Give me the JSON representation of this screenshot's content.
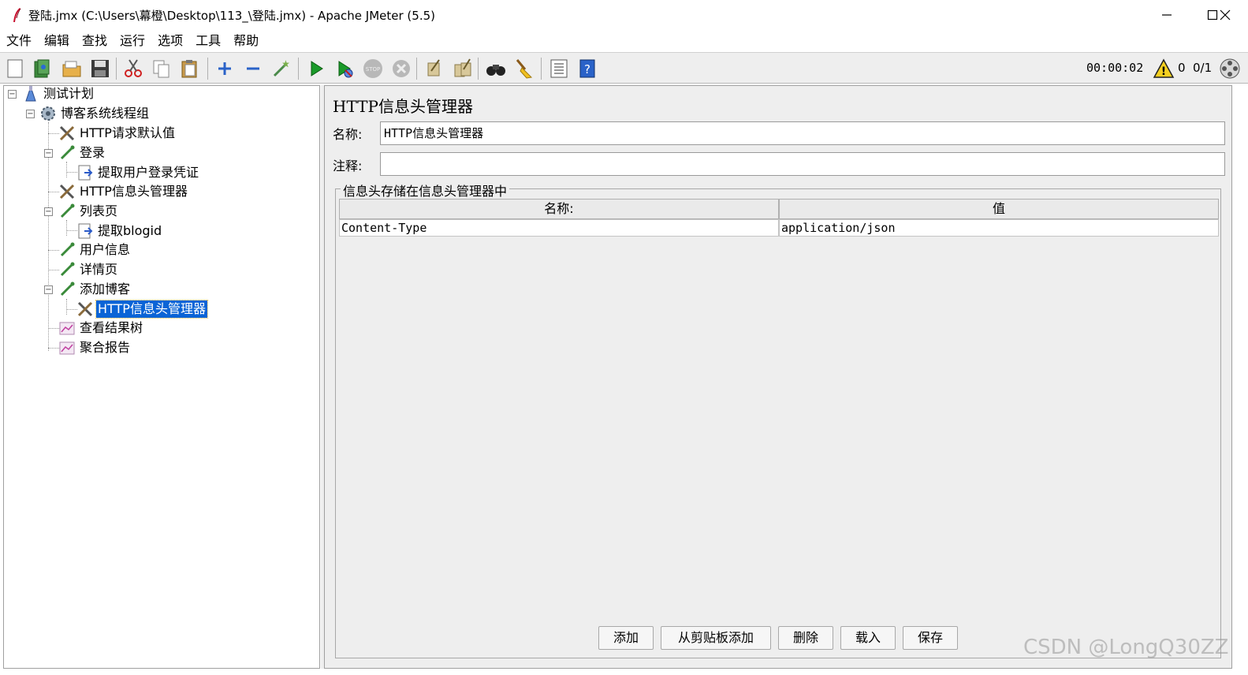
{
  "window": {
    "title": "登陆.jmx (C:\\Users\\幕橙\\Desktop\\113_\\登陆.jmx) - Apache JMeter (5.5)"
  },
  "menu": [
    "文件",
    "编辑",
    "查找",
    "运行",
    "选项",
    "工具",
    "帮助"
  ],
  "toolbar": {
    "timer": "00:00:02",
    "error_count": "0",
    "thread_count": "0/1"
  },
  "tree": {
    "items": [
      {
        "label": "测试计划",
        "icon": "test-plan-icon"
      },
      {
        "label": "博客系统线程组",
        "icon": "thread-group-gear-icon"
      },
      {
        "label": "HTTP请求默认值",
        "icon": "config-tools-icon"
      },
      {
        "label": "登录",
        "icon": "sampler-pipette-icon"
      },
      {
        "label": "提取用户登录凭证",
        "icon": "extractor-icon"
      },
      {
        "label": "HTTP信息头管理器",
        "icon": "config-tools-icon"
      },
      {
        "label": "列表页",
        "icon": "sampler-pipette-icon"
      },
      {
        "label": "提取blogid",
        "icon": "extractor-icon"
      },
      {
        "label": "用户信息",
        "icon": "sampler-pipette-icon"
      },
      {
        "label": "详情页",
        "icon": "sampler-pipette-icon"
      },
      {
        "label": "添加博客",
        "icon": "sampler-pipette-icon"
      },
      {
        "label": "HTTP信息头管理器",
        "icon": "config-tools-icon"
      },
      {
        "label": "查看结果树",
        "icon": "listener-graph-icon"
      },
      {
        "label": "聚合报告",
        "icon": "listener-graph-icon"
      }
    ]
  },
  "editor": {
    "title": "HTTP信息头管理器",
    "name_label": "名称:",
    "name_value": "HTTP信息头管理器",
    "comment_label": "注释:",
    "comment_value": "",
    "group_title": "信息头存储在信息头管理器中",
    "columns": [
      "名称:",
      "值"
    ],
    "rows": [
      [
        "Content-Type",
        "application/json"
      ]
    ],
    "buttons": [
      "添加",
      "从剪贴板添加",
      "删除",
      "载入",
      "保存"
    ]
  },
  "watermark": "CSDN @LongQ30ZZ",
  "colors": {
    "selection": "#0a64d6",
    "panel_bg": "#eeeeee"
  }
}
